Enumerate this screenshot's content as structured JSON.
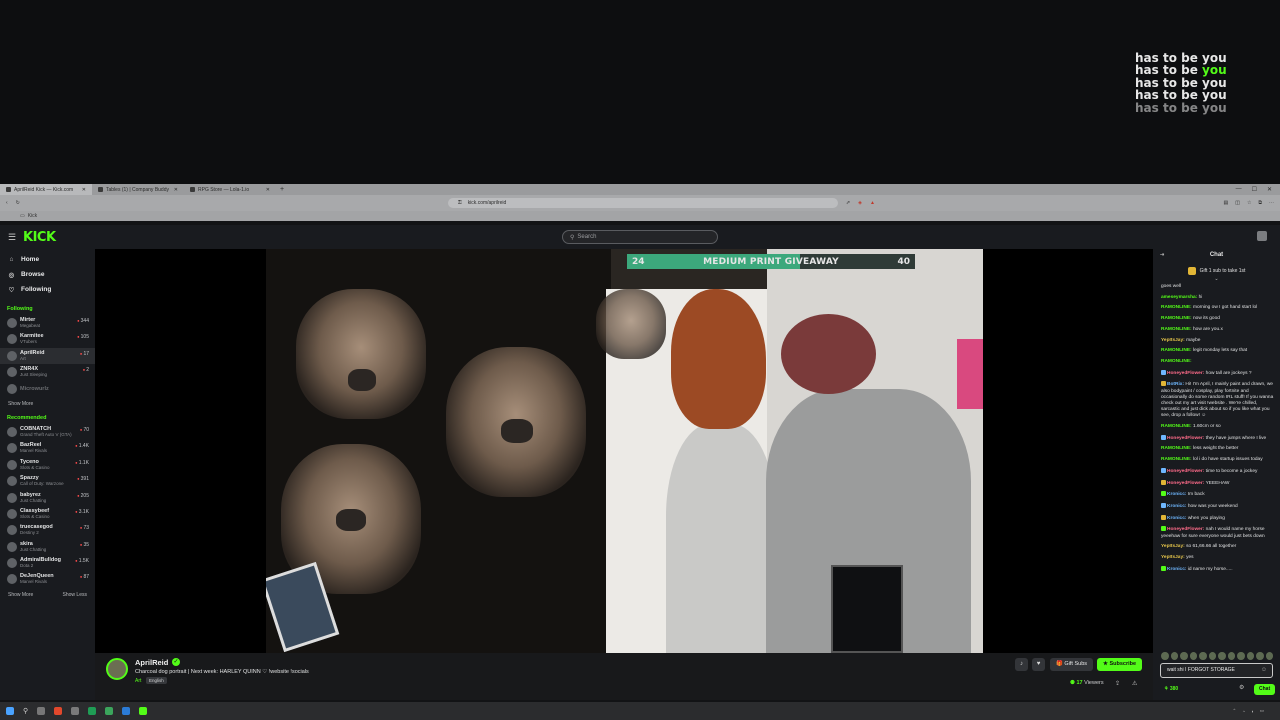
{
  "overlay": {
    "lines": [
      "has to be you",
      "has to be you",
      "has to be you",
      "has to be you",
      "has to be you"
    ],
    "accent_color": "#53fc18"
  },
  "browser": {
    "tabs": [
      "AprilReid Kick — Kick.com",
      "Tables (1) | Company Buddy",
      "RPG Store — Lola-1.io"
    ],
    "url": "kick.com/aprilreid",
    "bookmark": "Kick"
  },
  "app": {
    "logo": "KICK",
    "search_placeholder": "Search",
    "nav": [
      {
        "icon": "home-icon",
        "label": "Home"
      },
      {
        "icon": "compass-icon",
        "label": "Browse"
      },
      {
        "icon": "heart-icon",
        "label": "Following"
      }
    ],
    "following_title": "Following",
    "following": [
      {
        "name": "Mirter",
        "category": "Megabeat",
        "viewers": "344"
      },
      {
        "name": "Karmitee",
        "category": "VTubers",
        "viewers": "105"
      },
      {
        "name": "AprilReid",
        "category": "Art",
        "viewers": "17"
      },
      {
        "name": "ZNR4X",
        "category": "Just Sleeping",
        "viewers": "2"
      },
      {
        "name": "Microwurlz",
        "category": "",
        "viewers": ""
      }
    ],
    "show_more": "Show More",
    "recommended_title": "Recommended",
    "recommended": [
      {
        "name": "COBNATCH",
        "category": "Grand Theft Auto V (GTA)",
        "viewers": "70"
      },
      {
        "name": "BazReel",
        "category": "Marvel Rivals",
        "viewers": "1.4K"
      },
      {
        "name": "Tyceno",
        "category": "Slots & Casino",
        "viewers": "1.1K"
      },
      {
        "name": "Spazzy",
        "category": "Call of Duty: Warzone",
        "viewers": "391"
      },
      {
        "name": "babyrez",
        "category": "Just Chatting",
        "viewers": "205"
      },
      {
        "name": "Classybeef",
        "category": "Slots & Casino",
        "viewers": "3.1K"
      },
      {
        "name": "truecasegod",
        "category": "Destiny 2",
        "viewers": "73"
      },
      {
        "name": "skira",
        "category": "Just Chatting",
        "viewers": "35"
      },
      {
        "name": "AdmiralBulldog",
        "category": "Dota 2",
        "viewers": "1.5K"
      },
      {
        "name": "DeJenQueen",
        "category": "Marvel Rivals",
        "viewers": "87"
      }
    ],
    "show_less": "Show Less"
  },
  "player": {
    "giveaway_left": "24",
    "giveaway_title": "MEDIUM PRINT GIVEAWAY",
    "giveaway_right": "40",
    "giveaway_progress": 0.6
  },
  "stream": {
    "streamer": "AprilReid",
    "title": "Charcoal dog portrait  |  Next week: HARLEY QUINN ♡ !website !socials",
    "category": "Art",
    "language": "English",
    "gift_subs": "Gift Subs",
    "subscribe": "Subscribe",
    "viewers": "17",
    "viewers_label": "Viewers"
  },
  "chat": {
    "title": "Chat",
    "gift_banner": "Gift 1 sub to take 1st",
    "messages": [
      {
        "user": "",
        "text": "goes well",
        "color": ""
      },
      {
        "user": "ameseymarsha:",
        "text": "hi",
        "color": "g"
      },
      {
        "user": "RAMONLINE:",
        "text": "morning ow I got hand start lol",
        "color": "g"
      },
      {
        "user": "RAMONLINE:",
        "text": "now its good",
        "color": "g"
      },
      {
        "user": "RAMONLINE:",
        "text": "how are you.x",
        "color": "g"
      },
      {
        "user": "YepItsJay:",
        "text": "maybe",
        "color": "y"
      },
      {
        "user": "RAMONLINE:",
        "text": "legit monday lets say that",
        "color": "g"
      },
      {
        "user": "RAMONLINE:",
        "text": "",
        "color": "g"
      },
      {
        "user": "HoneyedFlower:",
        "text": "how tall are jockeys ?",
        "color": "r"
      },
      {
        "user": "BotRix:",
        "text": "Hi! I'm April, I mainly paint and drawn, we also bodypaint / cosplay, play fortnite and occasionally do some random IRL stuff! If you wanna check out my art visit !website . We're chilled, sarcastic and just dick about so if you like what you see, drop a follow! ☺",
        "color": "b"
      },
      {
        "user": "RAMONLINE:",
        "text": "1.60cm or so",
        "color": "g"
      },
      {
        "user": "HoneyedFlower:",
        "text": "they have jumps where I live",
        "color": "r"
      },
      {
        "user": "RAMONLINE:",
        "text": "less weight the better",
        "color": "g"
      },
      {
        "user": "RAMONLINE:",
        "text": "lol i do have startup issues today",
        "color": "g"
      },
      {
        "user": "HoneyedFlower:",
        "text": "time to become a jockey",
        "color": "r"
      },
      {
        "user": "HoneyedFlower:",
        "text": "YEEEHAW",
        "color": "r"
      },
      {
        "user": "Kronicc:",
        "text": "Im back",
        "color": "b"
      },
      {
        "user": "Kronicc:",
        "text": "how was your weekend",
        "color": "b"
      },
      {
        "user": "Kronicc:",
        "text": "when you playing",
        "color": "b"
      },
      {
        "user": "HoneyedFlower:",
        "text": "nah I would name my horse yeeehaw for sure everyone would just bets down",
        "color": "r"
      },
      {
        "user": "YepItsJay:",
        "text": "so 61,66.66 all together",
        "color": "y"
      },
      {
        "user": "YepItsJay:",
        "text": "yes",
        "color": "y"
      },
      {
        "user": "Kronicc:",
        "text": "id name my horse.....",
        "color": "b"
      }
    ],
    "input_value": "wait shi I FORGOT STORAGE",
    "points": "380",
    "send": "Chat"
  }
}
